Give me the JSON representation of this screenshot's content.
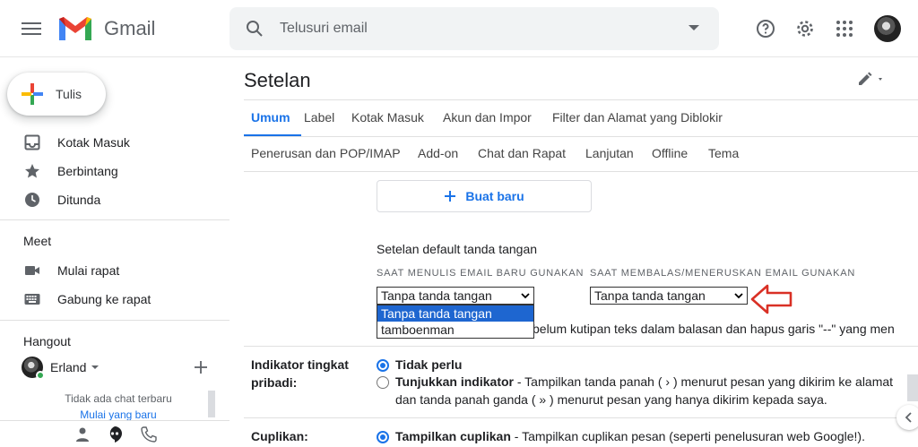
{
  "app": {
    "name": "Gmail"
  },
  "search": {
    "placeholder": "Telusuri email"
  },
  "sidebar": {
    "compose_label": "Tulis",
    "items": [
      {
        "label": "Kotak Masuk"
      },
      {
        "label": "Berbintang"
      },
      {
        "label": "Ditunda"
      }
    ],
    "meet": {
      "title": "Meet",
      "items": [
        {
          "label": "Mulai rapat"
        },
        {
          "label": "Gabung ke rapat"
        }
      ]
    },
    "hangout": {
      "title": "Hangout",
      "user": "Erland",
      "no_chat": "Tidak ada chat terbaru",
      "start_new": "Mulai yang baru"
    }
  },
  "main": {
    "title": "Setelan",
    "tabs_row1": [
      {
        "label": "Umum"
      },
      {
        "label": "Label"
      },
      {
        "label": "Kotak Masuk"
      },
      {
        "label": "Akun dan Impor"
      },
      {
        "label": "Filter dan Alamat yang Diblokir"
      }
    ],
    "tabs_row2": [
      {
        "label": "Penerusan dan POP/IMAP"
      },
      {
        "label": "Add-on"
      },
      {
        "label": "Chat dan Rapat"
      },
      {
        "label": "Lanjutan"
      },
      {
        "label": "Offline"
      },
      {
        "label": "Tema"
      }
    ],
    "new_button": "Buat baru",
    "signature_defaults": {
      "heading": "Setelan default tanda tangan",
      "new_email_label": "SAAT MENULIS EMAIL BARU GUNAKAN",
      "reply_label": "SAAT MEMBALAS/MENERUSKAN EMAIL GUNAKAN",
      "new_email_value": "Tanpa tanda tangan",
      "reply_value": "Tanpa tanda tangan",
      "dropdown_options": [
        "Tanpa tanda tangan",
        "tamboenman"
      ],
      "below_text": "belum kutipan teks dalam balasan dan hapus garis \"--\" yang men"
    },
    "personal_indicator": {
      "label_line1": "Indikator tingkat",
      "label_line2": "pribadi:",
      "option1_bold": "Tidak perlu",
      "option2_bold": "Tunjukkan indikator",
      "option2_rest": " - Tampilkan tanda panah ( › ) menurut pesan yang dikirim ke alamat",
      "option2_line2": "dan tanda panah ganda ( » ) menurut pesan yang hanya dikirim kepada saya."
    },
    "snippets": {
      "label": "Cuplikan:",
      "option1_bold": "Tampilkan cuplikan",
      "option1_rest": " - Tampilkan cuplikan pesan (seperti penelusuran web Google!)."
    }
  },
  "colors": {
    "accent": "#1a73e8",
    "arrow": "#d93025",
    "dropdown_highlight": "#1e66d0"
  }
}
